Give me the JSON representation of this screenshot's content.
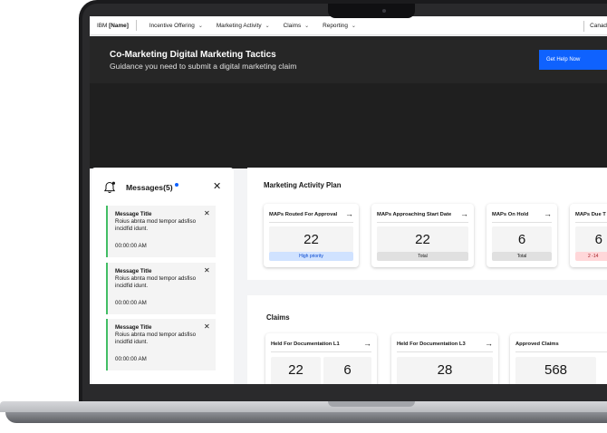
{
  "nav": {
    "brand_prefix": "IBM",
    "brand_name": "[Name]",
    "items": [
      {
        "label": "Incentive Offering"
      },
      {
        "label": "Marketing  Activity"
      },
      {
        "label": "Claims"
      },
      {
        "label": "Reporting"
      }
    ],
    "right_label": "Canad"
  },
  "hero": {
    "title": "Co-Marketing Digital Marketing Tactics",
    "subtitle": "Guidance you need to submit a digital marketing claim",
    "cta_label": "Get Help Now"
  },
  "messages": {
    "title": "Messages(5)",
    "items": [
      {
        "title": "Message Title",
        "body": "Roius abnta mod tempor adsfiso incidfid idunt.",
        "time": "00:00:00 AM"
      },
      {
        "title": "Message Title",
        "body": "Roius abnta mod tempor adsfiso incidfid idunt.",
        "time": "00:00:00 AM"
      },
      {
        "title": "Message Title",
        "body": "Roius abnta mod tempor adsfiso incidfid idunt.",
        "time": "00:00:00 AM"
      }
    ]
  },
  "map": {
    "title": "Marketing Activity Plan",
    "tiles": [
      {
        "label": "MAPs Routed For Approval",
        "value": "22",
        "tag": "High priority",
        "tag_color": "#d0e2ff"
      },
      {
        "label": "MAPs Approaching Start Date",
        "value": "22",
        "tag": "Total",
        "tag_color": "#e0e0e0"
      },
      {
        "label": "MAPs On Hold",
        "value": "6",
        "tag": "Total",
        "tag_color": "#e0e0e0"
      },
      {
        "label": "MAPs Due T",
        "value": "6",
        "tag": "2 -14",
        "tag_color": "#ffd7d9"
      }
    ]
  },
  "claims": {
    "title": "Claims",
    "tiles": [
      {
        "label": "Held For Documentation L1",
        "values": [
          "22",
          "6"
        ]
      },
      {
        "label": "Held For Documentation L3",
        "values": [
          "28"
        ]
      },
      {
        "label": "Approved Claims",
        "values": [
          "568"
        ]
      }
    ]
  },
  "colors": {
    "accent": "#0f62fe",
    "success": "#42be65",
    "hero_bg": "#262626"
  }
}
